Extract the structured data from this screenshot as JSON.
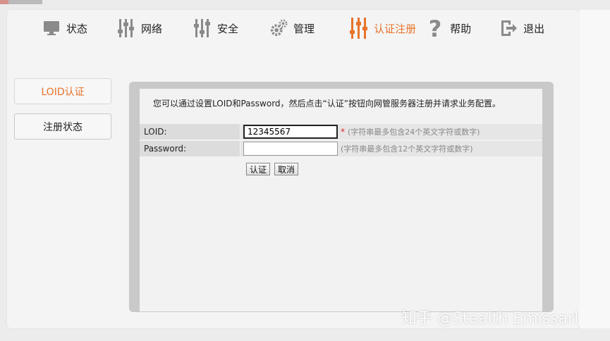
{
  "nav": {
    "items": [
      {
        "label": "状态",
        "icon": "monitor-icon"
      },
      {
        "label": "网络",
        "icon": "sliders-icon"
      },
      {
        "label": "安全",
        "icon": "sliders-icon"
      },
      {
        "label": "管理",
        "icon": "gears-icon"
      },
      {
        "label": "认证注册",
        "icon": "sliders-icon",
        "active": true
      },
      {
        "label": "帮助",
        "icon": "question-icon"
      },
      {
        "label": "退出",
        "icon": "exit-icon"
      }
    ],
    "accent_color": "#e8732a"
  },
  "sidebar": {
    "items": [
      {
        "label": "LOID认证",
        "active": true
      },
      {
        "label": "注册状态"
      }
    ]
  },
  "main": {
    "intro": "您可以通过设置LOID和Password，然后点击“认证”按钮向网管服务器注册并请求业务配置。",
    "form": {
      "loid": {
        "label": "LOID:",
        "value": "12345567",
        "required_mark": "*",
        "hint": "(字符串最多包含24个英文字符或数字)"
      },
      "password": {
        "label": "Password:",
        "value": "",
        "hint": "(字符串最多包含12个英文字符或数字)"
      }
    },
    "buttons": {
      "submit": "认证",
      "cancel": "取消"
    }
  },
  "watermark": "知乎 @Stealth Emissarl"
}
